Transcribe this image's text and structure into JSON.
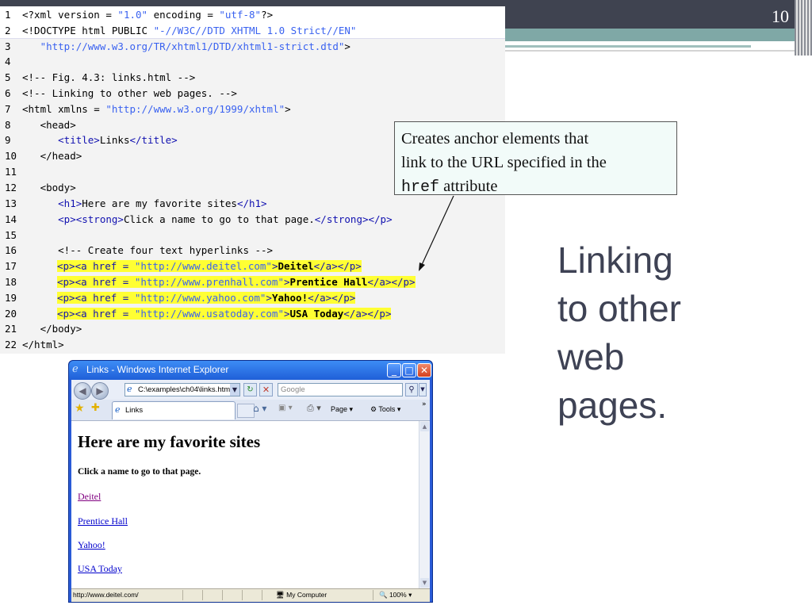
{
  "slide": {
    "page_number": "10",
    "heading": [
      "Linking",
      "to other",
      "web",
      "pages."
    ]
  },
  "callout": {
    "line1": "Creates anchor elements that",
    "line2": "link to the URL specified in the",
    "mono": "href",
    "tail": " attribute"
  },
  "code": {
    "line_numbers": [
      "1",
      "2",
      "3",
      "4",
      "5",
      "6",
      "7",
      "8",
      "9",
      "10",
      "11",
      "12",
      "13",
      "14",
      "15",
      "16",
      "17",
      "18",
      "19",
      "20",
      "21",
      "22"
    ],
    "l1a": "<?xml version = ",
    "l1b": "\"1.0\"",
    "l1c": " encoding = ",
    "l1d": "\"utf-8\"",
    "l1e": "?>",
    "l2a": "<!DOCTYPE html PUBLIC ",
    "l2b": "\"-//W3C//DTD XHTML 1.0 Strict//EN\"",
    "l3a": "   ",
    "l3b": "\"http://www.w3.org/TR/xhtml1/DTD/xhtml1-strict.dtd\"",
    "l3c": ">",
    "l5": "<!-- Fig. 4.3: links.html -->",
    "l6": "<!-- Linking to other web pages. -->",
    "l7a": "<html xmlns = ",
    "l7b": "\"http://www.w3.org/1999/xhtml\"",
    "l7c": ">",
    "l8": "   <head>",
    "l9a": "      <title>",
    "l9b": "Links",
    "l9c": "</title>",
    "l10": "   </head>",
    "l12": "   <body>",
    "l13a": "      <h1>",
    "l13b": "Here are my favorite sites",
    "l13c": "</h1>",
    "l14a": "      <p><strong>",
    "l14b": "Click a name to go to that page.",
    "l14c": "</strong></p>",
    "l16": "      <!-- Create four text hyperlinks -->",
    "l17a": "<p><a href = ",
    "l17b": "\"http://www.deitel.com\"",
    "l17c": ">",
    "l17d": "Deitel",
    "l17e": "</a></p>",
    "l18a": "<p><a href = ",
    "l18b": "\"http://www.prenhall.com\"",
    "l18c": ">",
    "l18d": "Prentice Hall",
    "l18e": "</a></p>",
    "l19a": "<p><a href = ",
    "l19b": "\"http://www.yahoo.com\"",
    "l19c": ">",
    "l19d": "Yahoo!",
    "l19e": "</a></p>",
    "l20a": "<p><a href = ",
    "l20b": "\"http://www.usatoday.com\"",
    "l20c": ">",
    "l20d": "USA Today",
    "l20e": "</a></p>",
    "l21": "   </body>",
    "l22": "</html>"
  },
  "browser": {
    "title": "Links - Windows Internet Explorer",
    "address": "C:\\examples\\ch04\\links.html",
    "search_placeholder": "Google",
    "tab_label": "Links",
    "toolbar_page": "Page",
    "toolbar_tools": "Tools",
    "heading": "Here are my favorite sites",
    "instruction": "Click a name to go to that page.",
    "links": [
      {
        "label": "Deitel",
        "color": "#800080"
      },
      {
        "label": "Prentice Hall",
        "color": "#0000cc"
      },
      {
        "label": "Yahoo!",
        "color": "#0000cc"
      },
      {
        "label": "USA Today",
        "color": "#0000cc"
      }
    ],
    "status_url": "http://www.deitel.com/",
    "status_zone": "My Computer",
    "status_zoom": "100%"
  }
}
